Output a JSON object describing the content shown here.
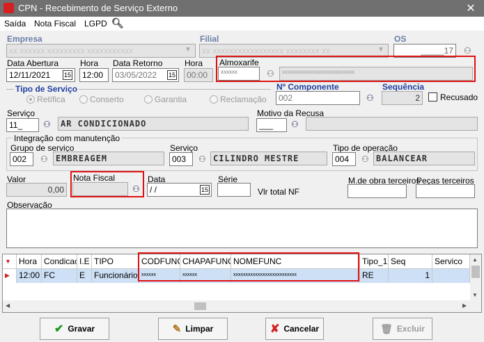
{
  "window": {
    "title": "CPN - Recebimento de Serviço Externo",
    "close": "✕"
  },
  "menu": [
    "Saída",
    "Nota Fiscal",
    "LGPD"
  ],
  "empresa": {
    "label": "Empresa",
    "value": "xx xxxxxx xxxxxxxxx xxxxxxxxxxx"
  },
  "filial": {
    "label": "Filial",
    "value": "xx xxxxxxxxxxxxxxxxx xxxxxxxx xx"
  },
  "os": {
    "label": "OS",
    "value": "_____17"
  },
  "data_abertura": {
    "label": "Data Abertura",
    "value": "12/11/2021"
  },
  "hora1": {
    "label": "Hora",
    "value": "12:00"
  },
  "data_retorno": {
    "label": "Data Retorno",
    "value": "03/05/2022"
  },
  "hora2": {
    "label": "Hora",
    "value": "00:00"
  },
  "almoxarife": {
    "label": "Almoxarife",
    "code": "xxxxxx",
    "name": "xxxxxxxxxxxxxxxxxxxxxxxxxx"
  },
  "tipo_servico": {
    "label": "Tipo de Serviço",
    "options": [
      "Retífica",
      "Conserto",
      "Garantia",
      "Reclamação"
    ]
  },
  "componente": {
    "label": "Nº  Componente",
    "value": "002"
  },
  "sequencia": {
    "label": "Sequência",
    "value": "2"
  },
  "recusado": {
    "label": "Recusado"
  },
  "servico": {
    "label": "Serviço",
    "code": "11_",
    "desc": "AR CONDICIONADO"
  },
  "motivo": {
    "label": "Motivo da Recusa",
    "value": "___"
  },
  "integracao": {
    "label": "Integração com manutenção",
    "grupo": {
      "label": "Grupo de serviço",
      "code": "002",
      "desc": "EMBREAGEM"
    },
    "servico": {
      "label": "Serviço",
      "code": "003",
      "desc": "CILINDRO MESTRE"
    },
    "tipo_op": {
      "label": "Tipo de operação",
      "code": "004",
      "desc": "BALANCEAR"
    }
  },
  "valor": {
    "label": "Valor",
    "value": "0,00"
  },
  "nota_fiscal": {
    "label": "Nota Fiscal",
    "value": ""
  },
  "data": {
    "label": "Data",
    "value": " / /"
  },
  "serie": {
    "label": "Série",
    "value": ""
  },
  "vlr_total": {
    "label": "Vlr total NF"
  },
  "mdo_terceiros": {
    "label": "M.de obra terceiros"
  },
  "pecas_terceiros": {
    "label": "Peças terceiros"
  },
  "observacao": {
    "label": "Observação"
  },
  "grid": {
    "columns": [
      "Hora",
      "Condicao",
      "I.E",
      "TIPO",
      "CODFUNC",
      "CHAPAFUNC",
      "NOMEFUNC",
      "Tipo_1",
      "Seq",
      "Servico"
    ],
    "rows": [
      [
        "12:00",
        "FC",
        "E",
        "Funcionário",
        "xxxxxx",
        "xxxxxx",
        "xxxxxxxxxxxxxxxxxxxxxxxxxx",
        "RE",
        "1",
        ""
      ]
    ]
  },
  "buttons": {
    "gravar": "Gravar",
    "limpar": "Limpar",
    "cancelar": "Cancelar",
    "excluir": "Excluir"
  }
}
